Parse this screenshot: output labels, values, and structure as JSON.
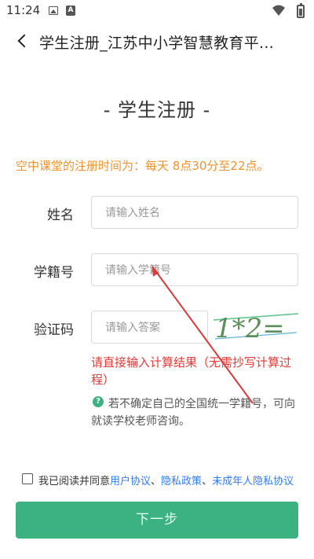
{
  "status_bar": {
    "time": "11:24",
    "image_icon": "image-icon",
    "a_icon_label": "A",
    "wifi_icon": "wifi-icon",
    "battery_icon": "battery-icon"
  },
  "top_bar": {
    "back_icon": "back-arrow-icon",
    "title": "学生注册_江苏中小学智慧教育平..."
  },
  "page_heading": "- 学生注册 -",
  "notice": "空中课堂的注册时间为：每天 8点30分至22点。",
  "form": {
    "name_label": "姓名",
    "name_placeholder": "请输入姓名",
    "student_id_label": "学籍号",
    "student_id_placeholder": "请输入学籍号",
    "captcha_label": "验证码",
    "captcha_placeholder": "请输入答案",
    "captcha_image_text": "1*2="
  },
  "error_text": "请直接输入计算结果（无需抄写计算过程）",
  "hint": {
    "icon": "question-circle-icon",
    "icon_glyph": "?",
    "text": "若不确定自己的全国统一学籍号，可向就读学校老师咨询。"
  },
  "agreement": {
    "prefix": "我已阅读并同意",
    "link_user": "用户协议",
    "sep1": "、",
    "link_privacy": "隐私政策",
    "sep2": "、",
    "link_minor": "未成年人隐私协议"
  },
  "next_button_label": "下一步",
  "colors": {
    "accent": "#3bb27f",
    "notice": "#f0932b",
    "error": "#e53935",
    "link": "#2f7cf6",
    "annotation": "#d63a3a"
  }
}
